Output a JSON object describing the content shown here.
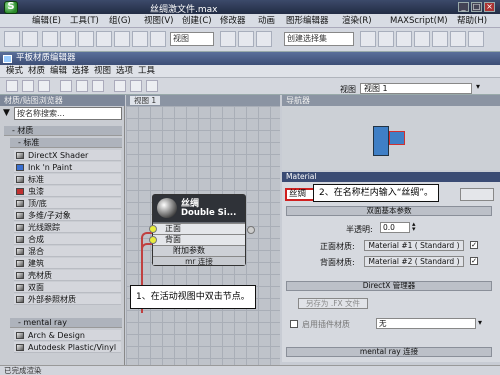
{
  "app": {
    "window_title": "丝绸激文件.max",
    "menu": [
      "编辑(E)",
      "工具(T)",
      "组(G)",
      "视图(V)",
      "创建(C)",
      "修改器",
      "动画",
      "图形编辑器",
      "渲染(R)",
      "MAXScript(M)",
      "帮助(H)"
    ],
    "toolbar": {
      "selection_set_placeholder": "创建选择集",
      "viewport_dropdown": "视图"
    }
  },
  "material_editor": {
    "title": "平板材质编辑器",
    "menu": [
      "模式",
      "材质",
      "编辑",
      "选择",
      "视图",
      "选项",
      "工具"
    ],
    "view_label": "视图 1",
    "browser": {
      "header": "材质/贴图浏览器",
      "search_placeholder": "按名称搜索...",
      "categories": [
        "- 材质",
        "- 标准",
        "- mental ray"
      ],
      "standard_materials": [
        "DirectX Shader",
        "Ink 'n Paint",
        "标准",
        "虫漆",
        "顶/底",
        "多维/子对象",
        "光线跟踪",
        "合成",
        "混合",
        "建筑",
        "壳材质",
        "双面",
        "外部参照材质"
      ],
      "mental_ray_materials": [
        "Arch & Design",
        "Autodesk Plastic/Vinyl"
      ]
    },
    "view": {
      "tab": "视图 1",
      "node": {
        "name": "丝绸",
        "type": "Double Si...",
        "slots": [
          "正面",
          "背面"
        ],
        "footer1": "附加参数",
        "footer2": "mr 连接"
      }
    },
    "navigator": {
      "header": "导航器"
    },
    "properties": {
      "header": "Material",
      "name_value": "丝绸",
      "rollout_basic": "双面基本参数",
      "translucency_label": "半透明:",
      "translucency_value": "0.0",
      "front_label": "正面材质:",
      "front_value": "Material #1 ( Standard )",
      "back_label": "背面材质:",
      "back_value": "Material #2 ( Standard )",
      "rollout_directx": "DirectX 管理器",
      "save_fx_button": "另存为 .FX 文件",
      "enable_plugin_label": "启用插件材质",
      "plugin_value": "无",
      "rollout_mr": "mental ray 连接"
    },
    "status": "已完成渲染"
  },
  "callouts": {
    "step1": "1、在活动视图中双击节点。",
    "step2": "2、在名称栏内输入“丝绸”。"
  },
  "colors": {
    "highlight_red": "#d02020",
    "node_slot_dot": "#e8ec3c"
  }
}
